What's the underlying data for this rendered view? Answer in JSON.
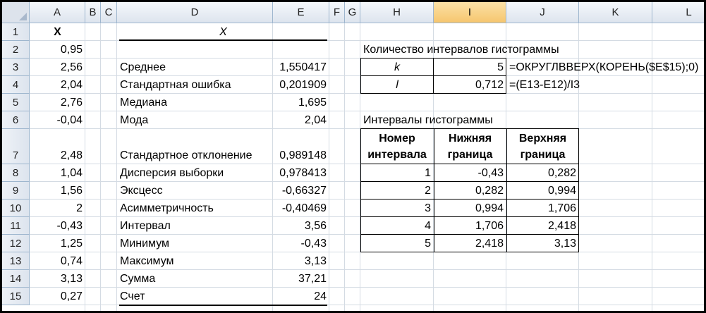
{
  "columns": [
    "A",
    "B",
    "C",
    "D",
    "E",
    "F",
    "G",
    "H",
    "I",
    "J",
    "K",
    "L"
  ],
  "selected_column": "I",
  "rows": [
    "1",
    "2",
    "3",
    "4",
    "5",
    "6",
    "7",
    "8",
    "9",
    "10",
    "11",
    "12",
    "13",
    "14",
    "15"
  ],
  "colA_header": "X",
  "colA_values": [
    "0,95",
    "2,56",
    "2,04",
    "2,76",
    "-0,04",
    "2,48",
    "1,04",
    "1,56",
    "2",
    "-0,43",
    "1,25",
    "0,74",
    "3,13",
    "0,27"
  ],
  "stats_header": "X",
  "stats": [
    {
      "label": "Среднее",
      "value": "1,550417"
    },
    {
      "label": "Стандартная ошибка",
      "value": "0,201909"
    },
    {
      "label": "Медиана",
      "value": "1,695"
    },
    {
      "label": "Мода",
      "value": "2,04"
    },
    {
      "label": "Стандартное отклонение",
      "value": "0,989148"
    },
    {
      "label": "Дисперсия выборки",
      "value": "0,978413"
    },
    {
      "label": "Эксцесс",
      "value": "-0,66327"
    },
    {
      "label": "Асимметричность",
      "value": "-0,40469"
    },
    {
      "label": "Интервал",
      "value": "3,56"
    },
    {
      "label": "Минимум",
      "value": "-0,43"
    },
    {
      "label": "Максимум",
      "value": "3,13"
    },
    {
      "label": "Сумма",
      "value": "37,21"
    },
    {
      "label": "Счет",
      "value": "24"
    }
  ],
  "intervals_count": {
    "title": "Количество интервалов гистограммы",
    "k_label": "k",
    "k_value": "5",
    "k_formula": "=ОКРУГЛВВЕРХ(КОРЕНЬ($E$15);0)",
    "l_label": "l",
    "l_value": "0,712",
    "l_formula": "=(E13-E12)/I3"
  },
  "histogram": {
    "title": "Интервалы гистограммы",
    "headers": [
      [
        "Номер",
        "интервала"
      ],
      [
        "Нижняя",
        "граница"
      ],
      [
        "Верхняя",
        "граница"
      ]
    ],
    "rows": [
      [
        "1",
        "-0,43",
        "0,282"
      ],
      [
        "2",
        "0,282",
        "0,994"
      ],
      [
        "3",
        "0,994",
        "1,706"
      ],
      [
        "4",
        "1,706",
        "2,418"
      ],
      [
        "5",
        "2,418",
        "3,13"
      ]
    ]
  }
}
